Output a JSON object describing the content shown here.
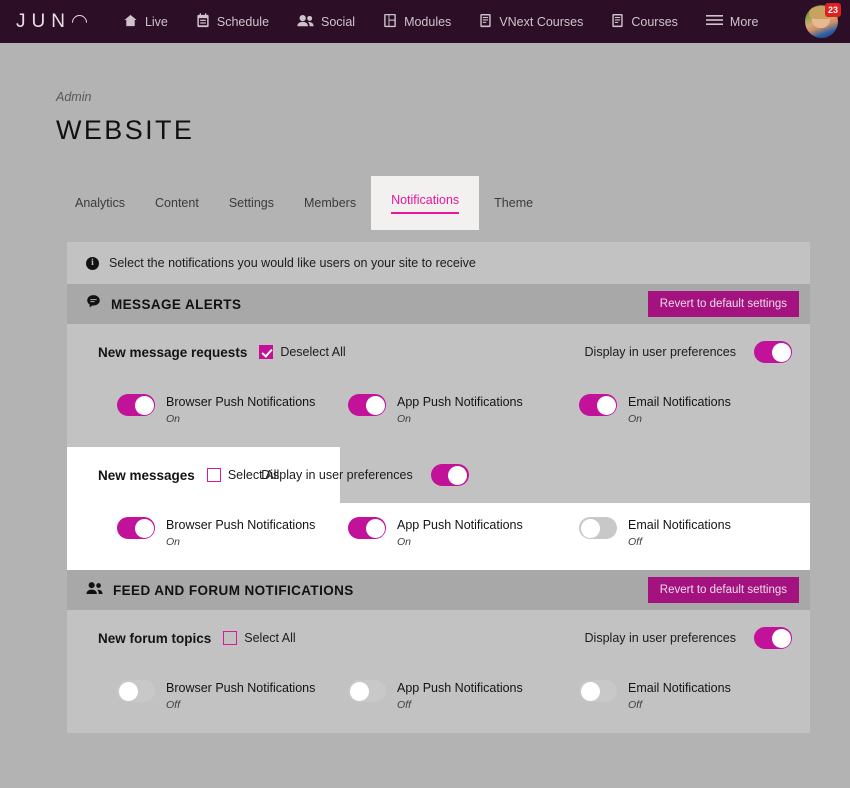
{
  "nav": {
    "logo": "JUNO",
    "items": [
      {
        "label": "Live",
        "icon": "home-icon"
      },
      {
        "label": "Schedule",
        "icon": "calendar-icon"
      },
      {
        "label": "Social",
        "icon": "people-icon"
      },
      {
        "label": "Modules",
        "icon": "modules-icon"
      },
      {
        "label": "VNext Courses",
        "icon": "book-icon"
      },
      {
        "label": "Courses",
        "icon": "book-icon"
      },
      {
        "label": "More",
        "icon": "hamburger-icon"
      }
    ],
    "avatar_badge": "23"
  },
  "header": {
    "eyebrow": "Admin",
    "title": "WEBSITE"
  },
  "tabs": [
    {
      "label": "Analytics",
      "active": false
    },
    {
      "label": "Content",
      "active": false
    },
    {
      "label": "Settings",
      "active": false
    },
    {
      "label": "Members",
      "active": false
    },
    {
      "label": "Notifications",
      "active": true
    },
    {
      "label": "Theme",
      "active": false
    }
  ],
  "info_banner": {
    "icon": "info-icon",
    "text": "Select the notifications you would like users on your site to receive"
  },
  "sections": [
    {
      "title": "MESSAGE ALERTS",
      "icon": "chat-bubble-icon",
      "revert_label": "Revert to default settings",
      "groups": [
        {
          "name": "New message requests",
          "select_label": "Deselect All",
          "select_checked": true,
          "pref_label": "Display in user preferences",
          "pref_on": true,
          "highlighted": false,
          "toggles": [
            {
              "label": "Browser Push Notifications",
              "state": "On",
              "on": true
            },
            {
              "label": "App Push Notifications",
              "state": "On",
              "on": true
            },
            {
              "label": "Email Notifications",
              "state": "On",
              "on": true
            }
          ]
        },
        {
          "name": "New messages",
          "select_label": "Select All",
          "select_checked": false,
          "pref_label": "Display in user preferences",
          "pref_on": true,
          "highlighted": true,
          "toggles": [
            {
              "label": "Browser Push Notifications",
              "state": "On",
              "on": true
            },
            {
              "label": "App Push Notifications",
              "state": "On",
              "on": true
            },
            {
              "label": "Email Notifications",
              "state": "Off",
              "on": false
            }
          ]
        }
      ]
    },
    {
      "title": "FEED AND FORUM NOTIFICATIONS",
      "icon": "group-icon",
      "revert_label": "Revert to default settings",
      "groups": [
        {
          "name": "New forum topics",
          "select_label": "Select All",
          "select_checked": false,
          "pref_label": "Display in user preferences",
          "pref_on": true,
          "highlighted": false,
          "toggles": [
            {
              "label": "Browser Push Notifications",
              "state": "Off",
              "on": false
            },
            {
              "label": "App Push Notifications",
              "state": "Off",
              "on": false
            },
            {
              "label": "Email Notifications",
              "state": "Off",
              "on": false
            }
          ]
        }
      ]
    }
  ],
  "colors": {
    "nav_bg": "#2c0f26",
    "accent_pink": "#e8179a",
    "magenta": "#c2129a",
    "button_magenta": "#a3127f",
    "page_bg": "#b3b3b3"
  }
}
